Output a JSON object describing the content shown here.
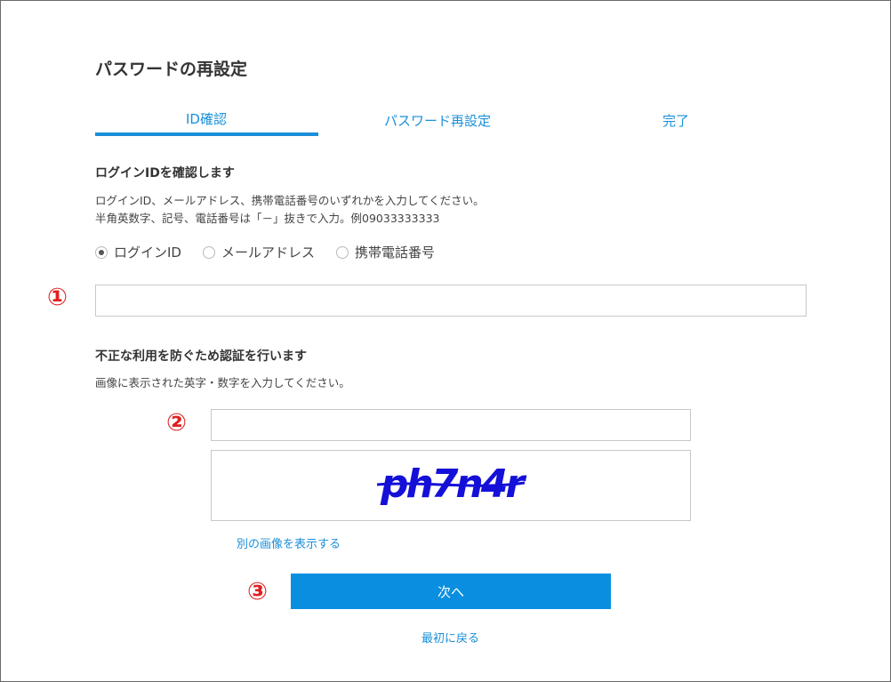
{
  "page": {
    "title": "パスワードの再設定"
  },
  "tabs": [
    {
      "label": "ID確認",
      "active": true
    },
    {
      "label": "パスワード再設定",
      "active": false
    },
    {
      "label": "完了",
      "active": false
    }
  ],
  "id_section": {
    "title": "ログインIDを確認します",
    "desc_line1": "ログインID、メールアドレス、携帯電話番号のいずれかを入力してください。",
    "desc_line2": "半角英数字、記号、電話番号は「－」抜きで入力。例09033333333",
    "radio_options": [
      {
        "label": "ログインID",
        "checked": true
      },
      {
        "label": "メールアドレス",
        "checked": false
      },
      {
        "label": "携帯電話番号",
        "checked": false
      }
    ],
    "input_value": "",
    "input_placeholder": ""
  },
  "captcha_section": {
    "title": "不正な利用を防ぐため認証を行います",
    "desc": "画像に表示された英字・数字を入力してください。",
    "input_value": "",
    "input_placeholder": "",
    "captcha_text": "ph7n4r",
    "captcha_color": "#1410d8",
    "refresh_link": "別の画像を表示する"
  },
  "actions": {
    "next_label": "次へ",
    "back_link": "最初に戻る"
  },
  "step_markers": [
    "①",
    "②",
    "③"
  ],
  "colors": {
    "accent": "#1a8fd9",
    "button": "#0a8fe0",
    "marker": "#e02020"
  }
}
